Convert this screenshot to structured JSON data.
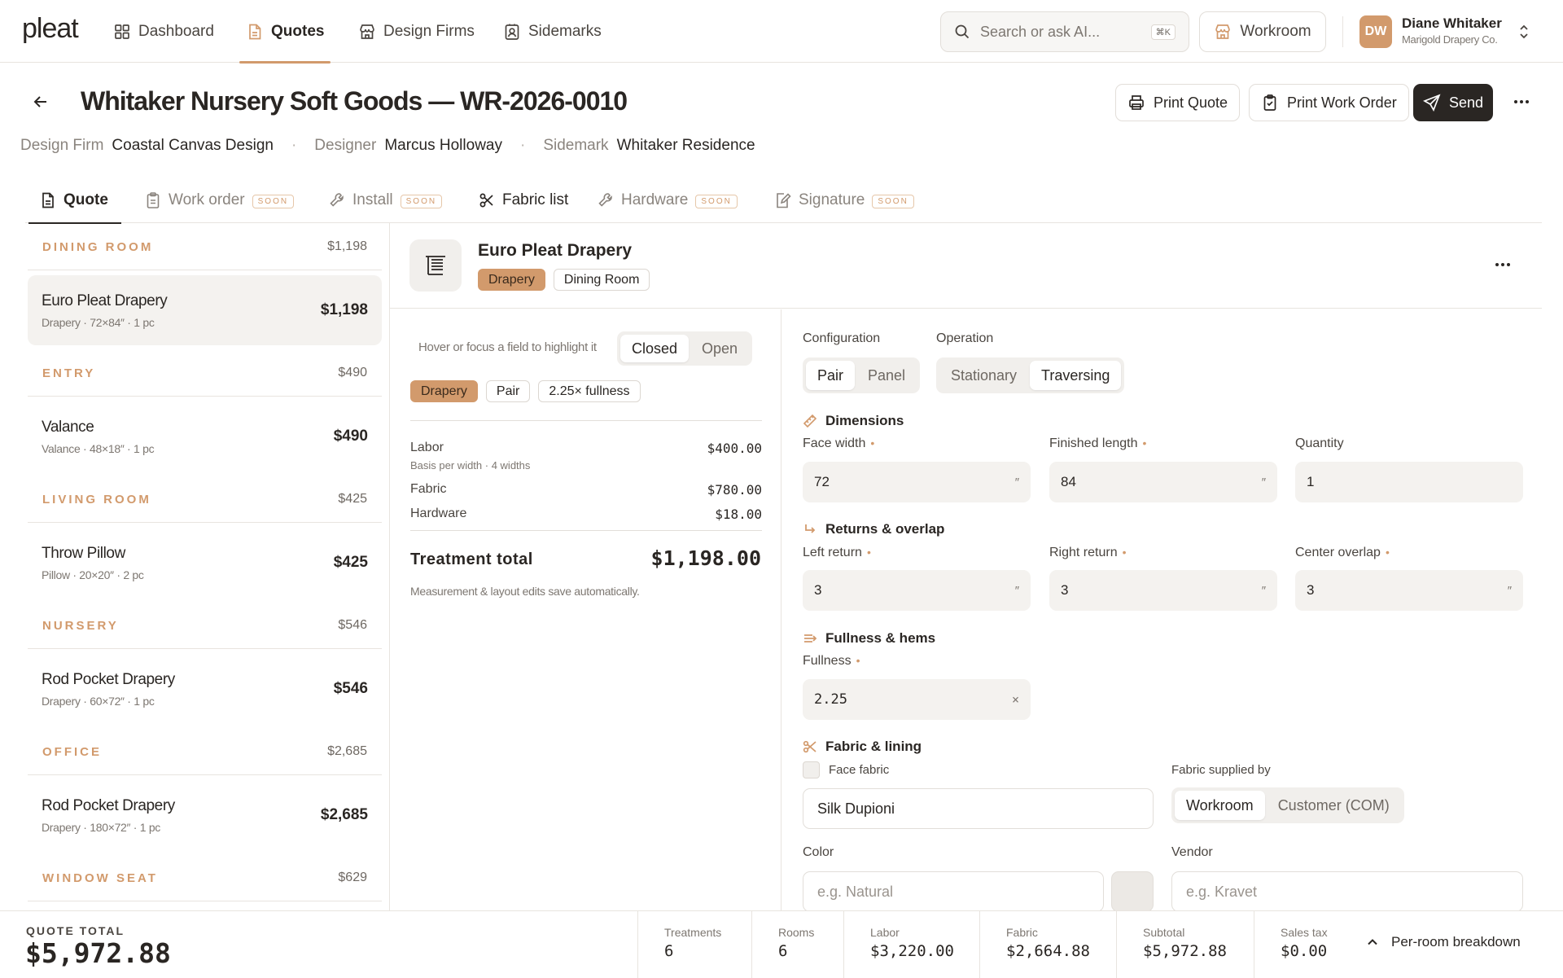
{
  "app": {
    "logo": "pleat"
  },
  "nav": [
    {
      "label": "Dashboard",
      "icon": "grid-icon"
    },
    {
      "label": "Quotes",
      "icon": "document-icon",
      "active": true
    },
    {
      "label": "Design Firms",
      "icon": "storefront-icon"
    },
    {
      "label": "Sidemarks",
      "icon": "contact-card-icon"
    }
  ],
  "search": {
    "placeholder": "Search or ask AI...",
    "shortcut": "⌘K"
  },
  "workroom_button": "Workroom",
  "user": {
    "initials": "DW",
    "name": "Diane Whitaker",
    "org": "Marigold Drapery Co."
  },
  "page": {
    "title": "Whitaker Nursery Soft Goods — WR-2026-0010",
    "actions": {
      "print_quote": "Print Quote",
      "print_work_order": "Print Work Order",
      "send": "Send"
    },
    "meta": {
      "design_firm_label": "Design Firm",
      "design_firm": "Coastal Canvas Design",
      "designer_label": "Designer",
      "designer": "Marcus Holloway",
      "sidemark_label": "Sidemark",
      "sidemark": "Whitaker Residence"
    }
  },
  "tabs": [
    {
      "label": "Quote",
      "badge": ""
    },
    {
      "label": "Work order",
      "badge": "SOON"
    },
    {
      "label": "Install",
      "badge": "SOON"
    },
    {
      "label": "Fabric list",
      "badge": ""
    },
    {
      "label": "Hardware",
      "badge": "SOON"
    },
    {
      "label": "Signature",
      "badge": "SOON"
    }
  ],
  "rooms": [
    {
      "name": "DINING ROOM",
      "total": "$1,198",
      "items": [
        {
          "name": "Euro Pleat Drapery",
          "sub": "Drapery · 72×84″ · 1 pc",
          "price": "$1,198",
          "selected": true
        }
      ]
    },
    {
      "name": "ENTRY",
      "total": "$490",
      "items": [
        {
          "name": "Valance",
          "sub": "Valance · 48×18″ · 1 pc",
          "price": "$490"
        }
      ]
    },
    {
      "name": "LIVING ROOM",
      "total": "$425",
      "items": [
        {
          "name": "Throw Pillow",
          "sub": "Pillow · 20×20″ · 2 pc",
          "price": "$425"
        }
      ]
    },
    {
      "name": "NURSERY",
      "total": "$546",
      "items": [
        {
          "name": "Rod Pocket Drapery",
          "sub": "Drapery · 60×72″ · 1 pc",
          "price": "$546"
        }
      ]
    },
    {
      "name": "OFFICE",
      "total": "$2,685",
      "items": [
        {
          "name": "Rod Pocket Drapery",
          "sub": "Drapery · 180×72″ · 1 pc",
          "price": "$2,685"
        }
      ]
    },
    {
      "name": "WINDOW SEAT",
      "total": "$629",
      "items": []
    }
  ],
  "detail": {
    "title": "Euro Pleat Drapery",
    "chips": [
      "Drapery",
      "Dining Room"
    ],
    "hint": "Hover or focus a field to highlight it",
    "view_toggle": {
      "closed": "Closed",
      "open": "Open"
    },
    "summary_chips": [
      "Drapery",
      "Pair",
      "2.25× fullness"
    ],
    "costs": {
      "labor_label": "Labor",
      "labor": "$400.00",
      "labor_basis": "Basis per width · 4 widths",
      "fabric_label": "Fabric",
      "fabric": "$780.00",
      "hardware_label": "Hardware",
      "hardware": "$18.00",
      "total_label": "Treatment total",
      "total": "$1,198.00"
    },
    "autosave_note": "Measurement & layout edits save automatically."
  },
  "form": {
    "configuration_label": "Configuration",
    "configuration": [
      "Pair",
      "Panel"
    ],
    "operation_label": "Operation",
    "operation": [
      "Stationary",
      "Traversing"
    ],
    "dimensions_title": "Dimensions",
    "face_width_label": "Face width",
    "face_width": "72",
    "inch_unit": "″",
    "finished_length_label": "Finished length",
    "finished_length": "84",
    "quantity_label": "Quantity",
    "quantity": "1",
    "returns_title": "Returns & overlap",
    "left_return_label": "Left return",
    "left_return": "3",
    "right_return_label": "Right return",
    "right_return": "3",
    "center_overlap_label": "Center overlap",
    "center_overlap": "3",
    "fullness_title": "Fullness & hems",
    "fullness_label": "Fullness",
    "fullness": "2.25",
    "fullness_unit": "×",
    "fabric_title": "Fabric & lining",
    "face_fabric_label": "Face fabric",
    "face_fabric": "Silk Dupioni",
    "supplied_by_label": "Fabric supplied by",
    "supplied_by": [
      "Workroom",
      "Customer (COM)"
    ],
    "color_label": "Color",
    "color_placeholder": "e.g. Natural",
    "vendor_label": "Vendor",
    "vendor_placeholder": "e.g. Kravet"
  },
  "footer": {
    "quote_total_label": "QUOTE TOTAL",
    "quote_total": "$5,972.88",
    "stats": [
      {
        "label": "Treatments",
        "value": "6"
      },
      {
        "label": "Rooms",
        "value": "6"
      },
      {
        "label": "Labor",
        "value": "$3,220.00"
      },
      {
        "label": "Fabric",
        "value": "$2,664.88"
      },
      {
        "label": "Subtotal",
        "value": "$5,972.88"
      },
      {
        "label": "Sales tax",
        "value": "$0.00"
      }
    ],
    "breakdown": "Per-room breakdown"
  },
  "colors": {
    "accent": "#d29a6c",
    "dark": "#2a2623",
    "border": "#e8e4df"
  }
}
